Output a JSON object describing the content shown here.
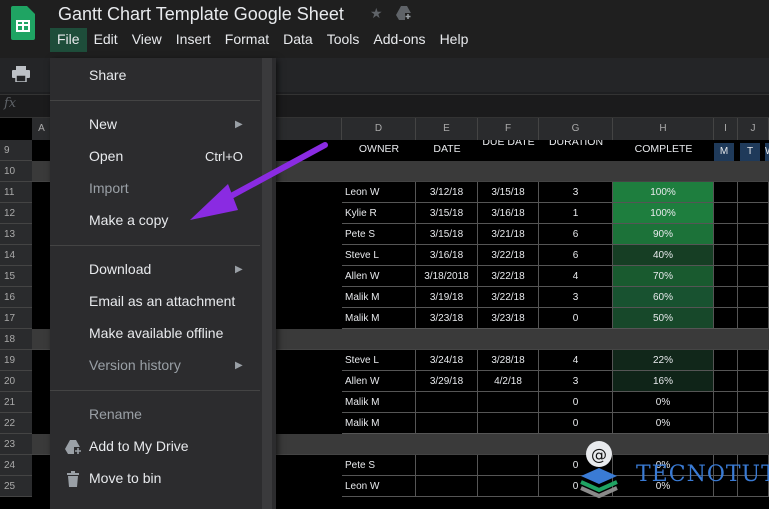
{
  "title_bar": {
    "doc_title": "Gantt Chart Template Google Sheet",
    "menu": [
      "File",
      "Edit",
      "View",
      "Insert",
      "Format",
      "Data",
      "Tools",
      "Add-ons",
      "Help"
    ]
  },
  "formula_bar": {
    "fx": "fx"
  },
  "columns": {
    "a": "A",
    "d": "D",
    "e": "E",
    "f": "F",
    "g": "G",
    "h": "H",
    "i": "I",
    "j": "J"
  },
  "table_headers": {
    "owner": "OWNER",
    "date": "DATE",
    "due_date": "DUE DATE",
    "duration": "DURATION",
    "complete": "COMPLETE",
    "day_m": "M",
    "day_t": "T",
    "day_w": "W"
  },
  "rows": [
    {
      "num": "9"
    },
    {
      "num": "10"
    },
    {
      "num": "11",
      "owner": "Leon W",
      "date": "3/12/18",
      "due": "3/15/18",
      "dur": "3",
      "pct": "100%",
      "fill": "#1e7e3e"
    },
    {
      "num": "12",
      "owner": "Kylie R",
      "date": "3/15/18",
      "due": "3/16/18",
      "dur": "1",
      "pct": "100%",
      "fill": "#1e7e3e"
    },
    {
      "num": "13",
      "owner": "Pete S",
      "date": "3/15/18",
      "due": "3/21/18",
      "dur": "6",
      "pct": "90%",
      "fill": "#1c7239"
    },
    {
      "num": "14",
      "owner": "Steve L",
      "date": "3/16/18",
      "due": "3/22/18",
      "dur": "6",
      "pct": "40%",
      "fill": "#163e24"
    },
    {
      "num": "15",
      "owner": "Allen W",
      "date": "3/18/2018",
      "due": "3/22/18",
      "dur": "4",
      "pct": "70%",
      "fill": "#195a2f"
    },
    {
      "num": "16",
      "owner": "Malik M",
      "date": "3/19/18",
      "due": "3/22/18",
      "dur": "3",
      "pct": "60%",
      "fill": "#185230"
    },
    {
      "num": "17",
      "owner": "Malik M",
      "date": "3/23/18",
      "due": "3/23/18",
      "dur": "0",
      "pct": "50%",
      "fill": "#17482a"
    },
    {
      "num": "18"
    },
    {
      "num": "19",
      "owner": "Steve L",
      "date": "3/24/18",
      "due": "3/28/18",
      "dur": "4",
      "pct": "22%",
      "fill": "#11271a"
    },
    {
      "num": "20",
      "owner": "Allen W",
      "date": "3/29/18",
      "due": "4/2/18",
      "dur": "3",
      "pct": "16%",
      "fill": "#0f2418"
    },
    {
      "num": "21",
      "owner": "Malik M",
      "date": "",
      "due": "",
      "dur": "0",
      "pct": "0%",
      "fill": "#000000"
    },
    {
      "num": "22",
      "owner": "Malik M",
      "date": "",
      "due": "",
      "dur": "0",
      "pct": "0%",
      "fill": "#000000"
    },
    {
      "num": "23"
    },
    {
      "num": "24",
      "owner": "Pete S",
      "date": "",
      "due": "",
      "dur": "0",
      "pct": "0%",
      "fill": "#000000"
    },
    {
      "num": "25",
      "owner": "Leon W",
      "date": "",
      "due": "",
      "dur": "0",
      "pct": "0%",
      "fill": "#000000"
    }
  ],
  "file_menu": {
    "share": "Share",
    "new": "New",
    "open": "Open",
    "open_shortcut": "Ctrl+O",
    "import": "Import",
    "make_copy": "Make a copy",
    "download": "Download",
    "email_attachment": "Email as an attachment",
    "make_offline": "Make available offline",
    "version_history": "Version history",
    "rename": "Rename",
    "add_to_drive": "Add to My Drive",
    "move_to_bin": "Move to bin"
  },
  "watermark": {
    "text": "TECNOTUTO"
  },
  "colors": {
    "accent_green": "#1fa463",
    "annotation_purple": "#8a2be2",
    "watermark_blue": "#3a7bd5"
  }
}
